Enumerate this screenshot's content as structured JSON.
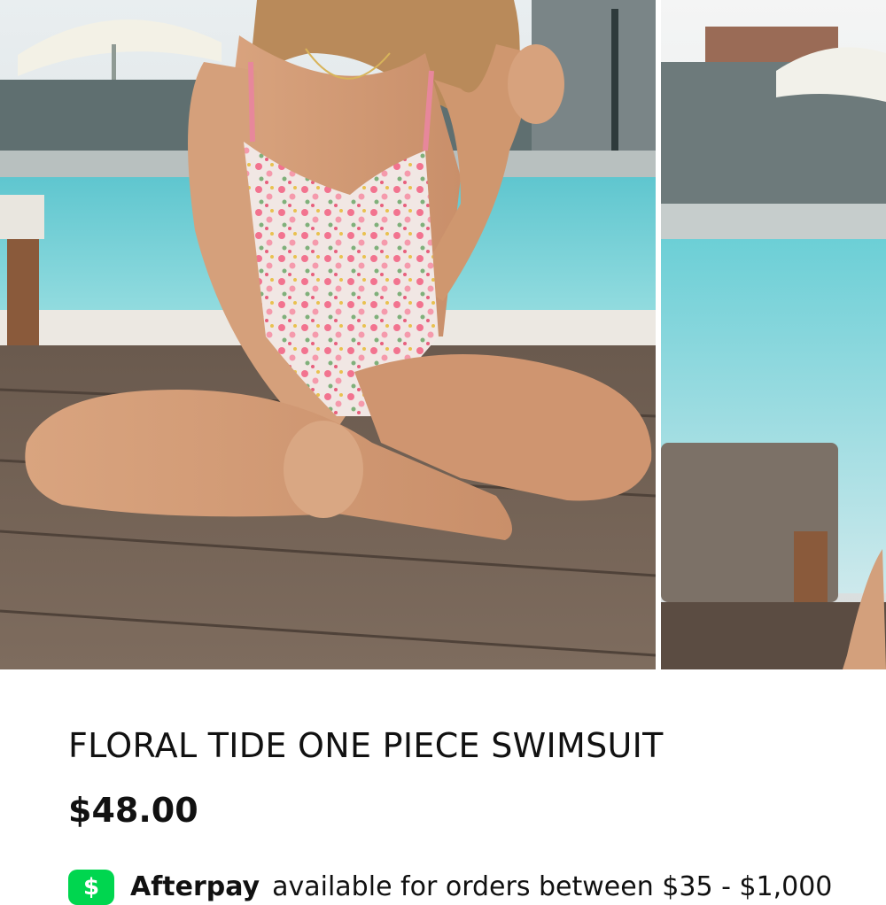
{
  "product": {
    "title": "FLORAL TIDE ONE PIECE SWIMSUIT",
    "price": "$48.00"
  },
  "gallery": {
    "main_image": "model-poolside-photo",
    "next_image": "pool-lounge-photo"
  },
  "payment": {
    "provider_icon": "cash-app-icon",
    "provider_icon_glyph": "$",
    "provider_icon_color": "#00D64F",
    "brand": "Afterpay",
    "text": "available for orders between $35 - $1,000"
  }
}
